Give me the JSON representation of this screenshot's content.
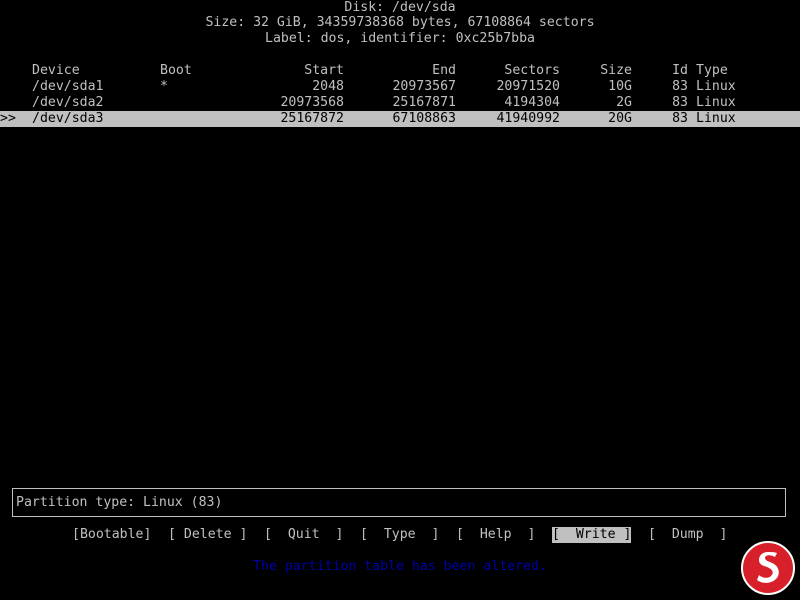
{
  "header": {
    "title": "Disk: /dev/sda",
    "size_line": "Size: 32 GiB, 34359738368 bytes, 67108864 sectors",
    "label_line": "Label: dos, identifier: 0xc25b7bba"
  },
  "table": {
    "columns": {
      "device": "Device",
      "boot": "Boot",
      "start": "Start",
      "end": "End",
      "sectors": "Sectors",
      "size": "Size",
      "id": "Id",
      "type": "Type"
    },
    "rows": [
      {
        "marker": "",
        "device": "/dev/sda1",
        "boot": "*",
        "start": "2048",
        "end": "20973567",
        "sectors": "20971520",
        "size": "10G",
        "id": "83",
        "type": "Linux"
      },
      {
        "marker": "",
        "device": "/dev/sda2",
        "boot": "",
        "start": "20973568",
        "end": "25167871",
        "sectors": "4194304",
        "size": "2G",
        "id": "83",
        "type": "Linux"
      },
      {
        "marker": ">>",
        "device": "/dev/sda3",
        "boot": "",
        "start": "25167872",
        "end": "67108863",
        "sectors": "41940992",
        "size": "20G",
        "id": "83",
        "type": "Linux"
      }
    ]
  },
  "info_panel": {
    "text": "Partition type: Linux (83)"
  },
  "menu": {
    "bootable": "[Bootable]",
    "delete": "[ Delete ]",
    "quit": "[  Quit  ]",
    "type": "[  Type  ]",
    "help": "[  Help  ]",
    "write": "[  Write ]",
    "dump": "[  Dump  ]"
  },
  "status": {
    "message": "The partition table has been altered."
  },
  "colors": {
    "background": "#000000",
    "foreground": "#c0c0c0",
    "status": "#0000a8",
    "logo_red": "#d8202a"
  },
  "icons": {
    "logo": "round-red-logo-icon"
  }
}
